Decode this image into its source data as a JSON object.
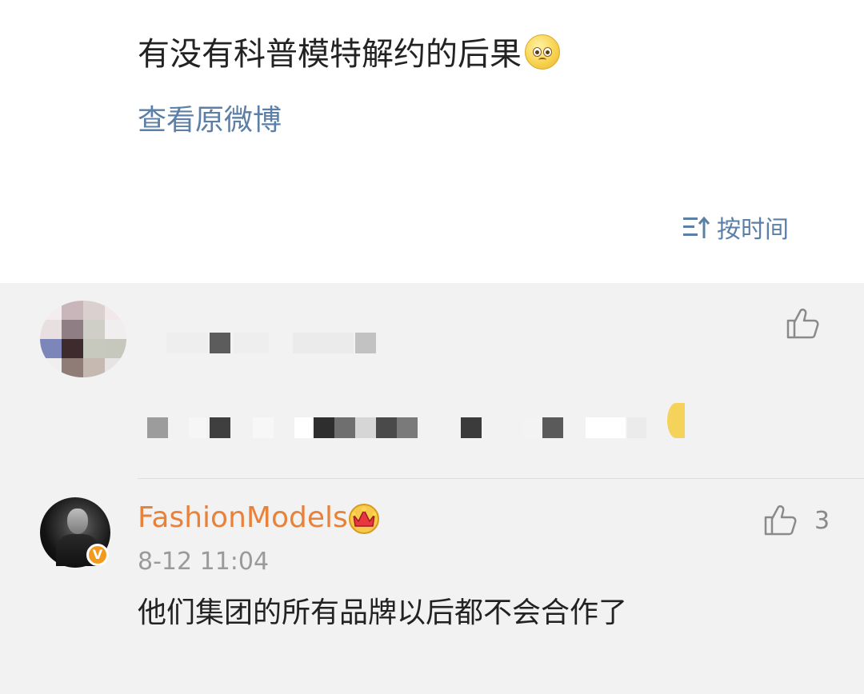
{
  "post": {
    "text": "有没有科普模特解约的后果",
    "emoji": "pleading-face",
    "view_original": "查看原微博"
  },
  "sort": {
    "label": "按时间"
  },
  "comments": [
    {
      "username": "FashionModels",
      "badge": "crown",
      "verified_mark": "V",
      "time": "8-12 11:04",
      "text": "他们集团的所有品牌以后都不会合作了",
      "likes": "3"
    }
  ],
  "colors": {
    "link": "#5b7fa6",
    "username": "#e8823a",
    "verified": "#f39a1e"
  }
}
